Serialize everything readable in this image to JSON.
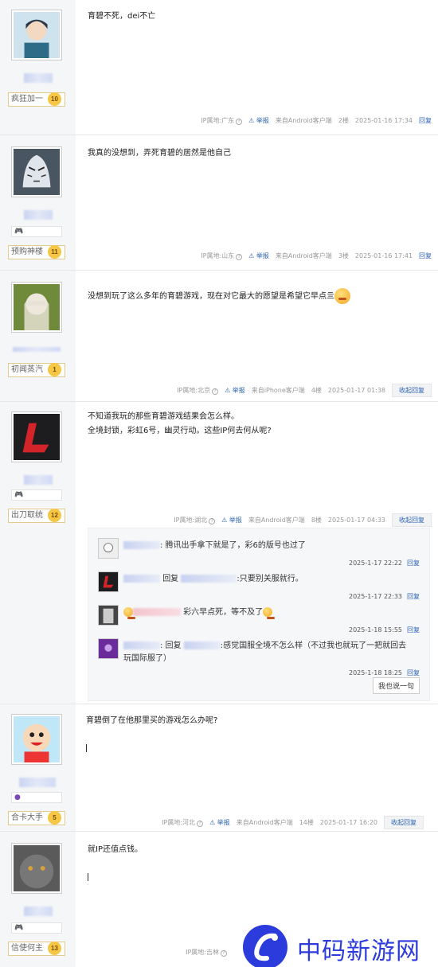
{
  "posts": [
    {
      "level_title": "疯狂加一",
      "level": "10",
      "content": "育碧不死，dei不亡",
      "ip": "IP属地:广东",
      "report": "举报",
      "client": "来自Android客户端",
      "floor": "2楼",
      "time": "2025-01-16 17:34",
      "reply": "回复"
    },
    {
      "level_title": "预购神楼",
      "level": "11",
      "content": "我真的没想到，弄死育碧的居然是他自己",
      "ip": "IP属地:山东",
      "report": "举报",
      "client": "来自Android客户端",
      "floor": "3楼",
      "time": "2025-01-16 17:41",
      "reply": "回复"
    },
    {
      "level_title": "初闻蒸汽",
      "level": "1",
      "content": "没想到玩了这么多年的育碧游戏，现在对它最大的愿望是希望它早点亖",
      "ip": "IP属地:北京",
      "report": "举报",
      "client": "来自iPhone客户端",
      "floor": "4楼",
      "time": "2025-01-17 01:38",
      "reply": "收起回复"
    },
    {
      "level_title": "出刀取统",
      "level": "12",
      "content_line1": "不知道我玩的那些育碧游戏结果会怎么样。",
      "content_line2": "全境封锁，彩虹6号，幽灵行动。这些IP何去何从呢?",
      "ip": "IP属地:湖北",
      "report": "举报",
      "client": "来自Android客户端",
      "floor": "8楼",
      "time": "2025-01-17 04:33",
      "reply": "收起回复",
      "sub_replies": [
        {
          "text": ": 腾讯出手拿下就是了，彩6的版号也过了",
          "time": "2025-1-17 22:22",
          "reply": "回复"
        },
        {
          "prefix": "回复",
          "text": ":只要别关服就行。",
          "time": "2025-1-17 22:33",
          "reply": "回复"
        },
        {
          "text": "彩六早点死，等不及了",
          "time": "2025-1-18 15:55",
          "reply": "回复"
        },
        {
          "prefix": ": 回复",
          "text": ":感觉国服全境不怎么样（不过我也就玩了一把就回去",
          "text2": "玩国际服了）",
          "time": "2025-1-18 18:25",
          "reply": "回复"
        }
      ],
      "i_say": "我也说一句"
    },
    {
      "level_title": "合卡大手",
      "level": "5",
      "content": "育碧倒了在他那里买的游戏怎么办呢?",
      "ip": "IP属地:河北",
      "report": "举报",
      "client": "来自Android客户端",
      "floor": "14楼",
      "time": "2025-01-17 16:20",
      "reply": "收起回复"
    },
    {
      "level_title": "信使何主",
      "level": "13",
      "content": "就IP还值点钱。",
      "ip": "IP属地:吉林"
    }
  ],
  "watermark": "中码新游网",
  "colors": {
    "link": "#2d64b3",
    "watermark": "#2c3bdb",
    "sidebar": "#f5f6f8"
  }
}
